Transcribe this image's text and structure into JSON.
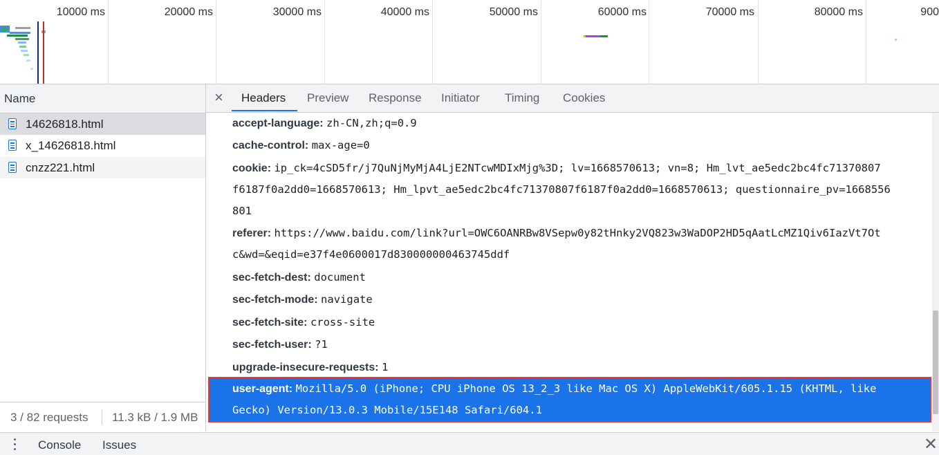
{
  "overview": {
    "ticks": [
      "10000 ms",
      "20000 ms",
      "30000 ms",
      "40000 ms",
      "50000 ms",
      "60000 ms",
      "70000 ms",
      "80000 ms",
      "900"
    ]
  },
  "left_pane": {
    "column_header": "Name",
    "requests": [
      "14626818.html",
      "x_14626818.html",
      "cnzz221.html"
    ],
    "footer_count": "3 / 82 requests",
    "footer_size": "11.3 kB / 1.9 MB"
  },
  "details": {
    "close_glyph": "×",
    "tabs": [
      "Headers",
      "Preview",
      "Response",
      "Initiator",
      "Timing",
      "Cookies"
    ],
    "active_tab": "Headers",
    "headers": [
      {
        "key": "accept-language:",
        "value": "zh-CN,zh;q=0.9"
      },
      {
        "key": "cache-control:",
        "value": "max-age=0"
      },
      {
        "key": "cookie:",
        "value": "ip_ck=4cSD5fr/j7QuNjMyMjA4LjE2NTcwMDIxMjg%3D; lv=1668570613; vn=8; Hm_lvt_ae5edc2bc4fc71370807",
        "cont1": "f6187f0a2dd0=1668570613; Hm_lpvt_ae5edc2bc4fc71370807f6187f0a2dd0=1668570613; questionnaire_pv=1668556",
        "cont2": "801"
      },
      {
        "key": "referer:",
        "value": "https://www.baidu.com/link?url=OWC6OANRBw8VSepw0y82tHnky2VQ823w3WaDOP2HD5qAatLcMZ1Qiv6IazVt7Ot",
        "cont1": "c&wd=&eqid=e37f4e0600017d830000000463745ddf"
      },
      {
        "key": "sec-fetch-dest:",
        "value": "document"
      },
      {
        "key": "sec-fetch-mode:",
        "value": "navigate"
      },
      {
        "key": "sec-fetch-site:",
        "value": "cross-site"
      },
      {
        "key": "sec-fetch-user:",
        "value": "?1"
      },
      {
        "key": "upgrade-insecure-requests:",
        "value": "1"
      },
      {
        "key": "user-agent:",
        "value": "Mozilla/5.0 (iPhone; CPU iPhone OS 13_2_3 like Mac OS X) AppleWebKit/605.1.15 (KHTML, like",
        "cont1": "Gecko) Version/13.0.3 Mobile/15E148 Safari/604.1"
      }
    ]
  },
  "drawer": {
    "tabs": [
      "Console",
      "Issues"
    ],
    "close_glyph": "✕"
  },
  "colors": {
    "selected_row": "#1a73e8",
    "highlight_border": "#e53935"
  }
}
